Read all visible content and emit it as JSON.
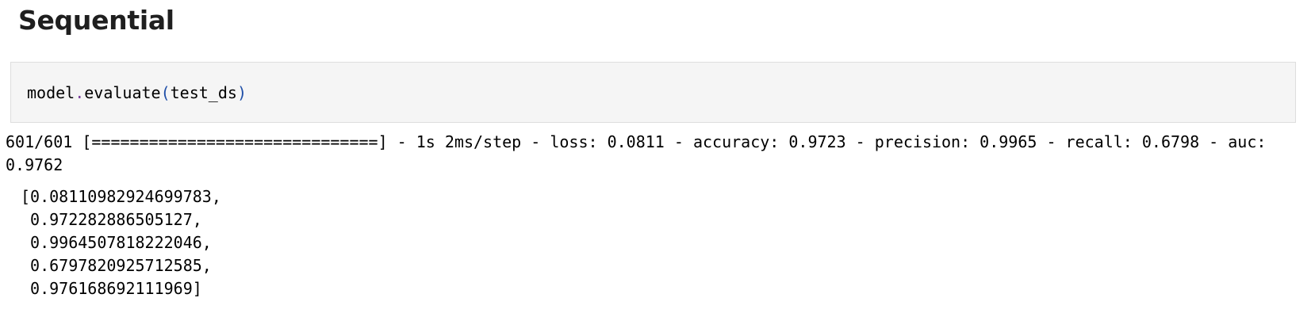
{
  "heading": "Sequential",
  "code_cell": {
    "obj": "model",
    "dot": ".",
    "method": "evaluate",
    "open_paren": "(",
    "arg": "test_ds",
    "close_paren": ")"
  },
  "output": {
    "progress_line": "601/601 [==============================] - 1s 2ms/step - loss: 0.0811 - accuracy: 0.9723 - precision: 0.9965 - recall: 0.6798 - auc: 0.9762",
    "result_line_1": "[0.08110982924699783,",
    "result_line_2": " 0.972282886505127,",
    "result_line_3": " 0.9964507818222046,",
    "result_line_4": " 0.6797820925712585,",
    "result_line_5": " 0.976168692111969]"
  }
}
